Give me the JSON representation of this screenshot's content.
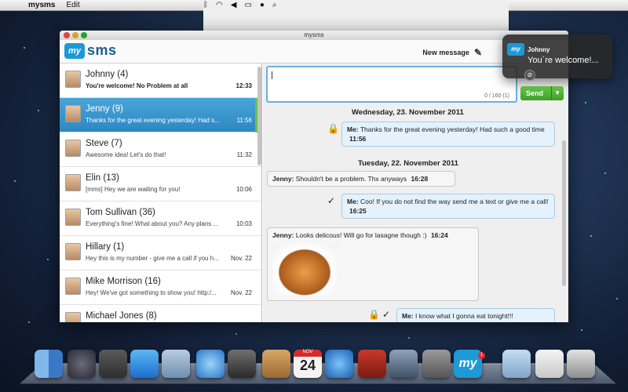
{
  "menubar": {
    "app": "mysms",
    "menu_edit": "Edit"
  },
  "window": {
    "title": "mysms"
  },
  "toolbar": {
    "logo_badge": "my",
    "logo_text": "sms",
    "new_message": "New message"
  },
  "conversations": [
    {
      "name": "Johnny (4)",
      "preview": "You're welcome! No Problem at all",
      "time": "12:33",
      "bold": true,
      "active": false
    },
    {
      "name": "Jenny (9)",
      "preview": "Thanks for the great evening yesterday! Had s...",
      "time": "11:56",
      "bold": false,
      "active": true
    },
    {
      "name": "Steve (7)",
      "preview": "Awesome idea! Let's do that!",
      "time": "11:32",
      "bold": false,
      "active": false
    },
    {
      "name": "Elin (13)",
      "preview": "[mms] Hey we are waiting for you!",
      "time": "10:06",
      "bold": false,
      "active": false
    },
    {
      "name": "Tom Sullivan (36)",
      "preview": "Everything's fine! What about you? Any plans ...",
      "time": "10:03",
      "bold": false,
      "active": false
    },
    {
      "name": "Hillary (1)",
      "preview": "Hey this is my number - give me a call if you h...",
      "time": "Nov. 22",
      "bold": false,
      "active": false
    },
    {
      "name": "Mike Morrison (16)",
      "preview": "Hey! We've got something to show you! http:/...",
      "time": "Nov. 22",
      "bold": false,
      "active": false
    },
    {
      "name": "Michael Jones (8)",
      "preview": "",
      "time": "",
      "bold": false,
      "active": false
    }
  ],
  "compose": {
    "counter": "0 / 160 (1)",
    "send_label": "Send"
  },
  "thread": {
    "date1": "Wednesday, 23. November 2011",
    "msg1": {
      "sender": "Me:",
      "text": "Thanks for the great evening yesterday! Had such a good time",
      "time": "11:56"
    },
    "date2": "Tuesday, 22. November 2011",
    "msg2": {
      "sender": "Jenny:",
      "text": "Shouldn't be a problem. Thx anyways",
      "time": "16:28"
    },
    "msg3": {
      "sender": "Me:",
      "text": "Coo! If you do not find the way send me a text or give me a call!",
      "time": "16:25"
    },
    "msg4": {
      "sender": "Jenny:",
      "text": "Looks delicous! Will go for lasagne though :)",
      "time": "16:24"
    },
    "msg5": {
      "sender": "Me:",
      "text": "I know what I gonna eat tonight!!!",
      "time": ""
    }
  },
  "notification": {
    "badge": "my",
    "name": "Johnny",
    "text": "You´re welcome!..."
  },
  "dock": {
    "calendar_month": "NOV",
    "calendar_day": "24",
    "mysms_badge": "1",
    "mysms_label": "my"
  }
}
